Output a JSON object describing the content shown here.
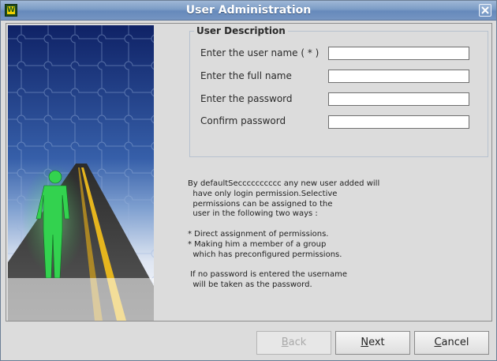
{
  "window": {
    "title": "User Administration",
    "app_icon_letter": "W"
  },
  "user_description": {
    "title": "User Description",
    "fields": [
      {
        "label": "Enter the user name ( * )",
        "value": ""
      },
      {
        "label": "Enter the full name",
        "value": ""
      },
      {
        "label": "Enter the password",
        "value": ""
      },
      {
        "label": "Confirm password",
        "value": ""
      }
    ]
  },
  "info_text": "By defaultSecccccccccc any new user added will\n  have only login permission.Selective\n  permissions can be assigned to the\n  user in the following two ways :\n\n* Direct assignment of permissions.\n* Making him a member of a group\n  which has preconfigured permissions.\n\n If no password is entered the username\n  will be taken as the password.",
  "buttons": {
    "back": {
      "mnemonic": "B",
      "rest": "ack",
      "enabled": false
    },
    "next": {
      "mnemonic": "N",
      "rest": "ext",
      "enabled": true
    },
    "cancel": {
      "mnemonic": "C",
      "rest": "ancel",
      "enabled": true
    }
  }
}
